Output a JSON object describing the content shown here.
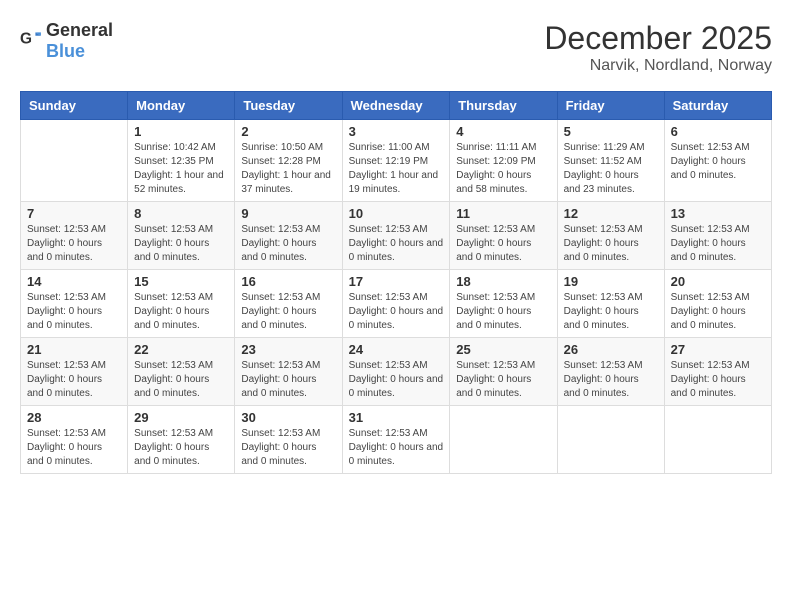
{
  "logo": {
    "general": "General",
    "blue": "Blue"
  },
  "title": {
    "month_year": "December 2025",
    "location": "Narvik, Nordland, Norway"
  },
  "weekdays": [
    "Sunday",
    "Monday",
    "Tuesday",
    "Wednesday",
    "Thursday",
    "Friday",
    "Saturday"
  ],
  "weeks": [
    [
      {
        "day": "",
        "info": ""
      },
      {
        "day": "1",
        "info": "Sunrise: 10:42 AM\nSunset: 12:35 PM\nDaylight: 1 hour and 52 minutes."
      },
      {
        "day": "2",
        "info": "Sunrise: 10:50 AM\nSunset: 12:28 PM\nDaylight: 1 hour and 37 minutes."
      },
      {
        "day": "3",
        "info": "Sunrise: 11:00 AM\nSunset: 12:19 PM\nDaylight: 1 hour and 19 minutes."
      },
      {
        "day": "4",
        "info": "Sunrise: 11:11 AM\nSunset: 12:09 PM\nDaylight: 0 hours and 58 minutes."
      },
      {
        "day": "5",
        "info": "Sunrise: 11:29 AM\nSunset: 11:52 AM\nDaylight: 0 hours and 23 minutes."
      },
      {
        "day": "6",
        "info": "Sunset: 12:53 AM\nDaylight: 0 hours and 0 minutes."
      }
    ],
    [
      {
        "day": "7",
        "info": "Sunset: 12:53 AM\nDaylight: 0 hours and 0 minutes."
      },
      {
        "day": "8",
        "info": "Sunset: 12:53 AM\nDaylight: 0 hours and 0 minutes."
      },
      {
        "day": "9",
        "info": "Sunset: 12:53 AM\nDaylight: 0 hours and 0 minutes."
      },
      {
        "day": "10",
        "info": "Sunset: 12:53 AM\nDaylight: 0 hours and 0 minutes."
      },
      {
        "day": "11",
        "info": "Sunset: 12:53 AM\nDaylight: 0 hours and 0 minutes."
      },
      {
        "day": "12",
        "info": "Sunset: 12:53 AM\nDaylight: 0 hours and 0 minutes."
      },
      {
        "day": "13",
        "info": "Sunset: 12:53 AM\nDaylight: 0 hours and 0 minutes."
      }
    ],
    [
      {
        "day": "14",
        "info": "Sunset: 12:53 AM\nDaylight: 0 hours and 0 minutes."
      },
      {
        "day": "15",
        "info": "Sunset: 12:53 AM\nDaylight: 0 hours and 0 minutes."
      },
      {
        "day": "16",
        "info": "Sunset: 12:53 AM\nDaylight: 0 hours and 0 minutes."
      },
      {
        "day": "17",
        "info": "Sunset: 12:53 AM\nDaylight: 0 hours and 0 minutes."
      },
      {
        "day": "18",
        "info": "Sunset: 12:53 AM\nDaylight: 0 hours and 0 minutes."
      },
      {
        "day": "19",
        "info": "Sunset: 12:53 AM\nDaylight: 0 hours and 0 minutes."
      },
      {
        "day": "20",
        "info": "Sunset: 12:53 AM\nDaylight: 0 hours and 0 minutes."
      }
    ],
    [
      {
        "day": "21",
        "info": "Sunset: 12:53 AM\nDaylight: 0 hours and 0 minutes."
      },
      {
        "day": "22",
        "info": "Sunset: 12:53 AM\nDaylight: 0 hours and 0 minutes."
      },
      {
        "day": "23",
        "info": "Sunset: 12:53 AM\nDaylight: 0 hours and 0 minutes."
      },
      {
        "day": "24",
        "info": "Sunset: 12:53 AM\nDaylight: 0 hours and 0 minutes."
      },
      {
        "day": "25",
        "info": "Sunset: 12:53 AM\nDaylight: 0 hours and 0 minutes."
      },
      {
        "day": "26",
        "info": "Sunset: 12:53 AM\nDaylight: 0 hours and 0 minutes."
      },
      {
        "day": "27",
        "info": "Sunset: 12:53 AM\nDaylight: 0 hours and 0 minutes."
      }
    ],
    [
      {
        "day": "28",
        "info": "Sunset: 12:53 AM\nDaylight: 0 hours and 0 minutes."
      },
      {
        "day": "29",
        "info": "Sunset: 12:53 AM\nDaylight: 0 hours and 0 minutes."
      },
      {
        "day": "30",
        "info": "Sunset: 12:53 AM\nDaylight: 0 hours and 0 minutes."
      },
      {
        "day": "31",
        "info": "Sunset: 12:53 AM\nDaylight: 0 hours and 0 minutes."
      },
      {
        "day": "",
        "info": ""
      },
      {
        "day": "",
        "info": ""
      },
      {
        "day": "",
        "info": ""
      }
    ]
  ]
}
